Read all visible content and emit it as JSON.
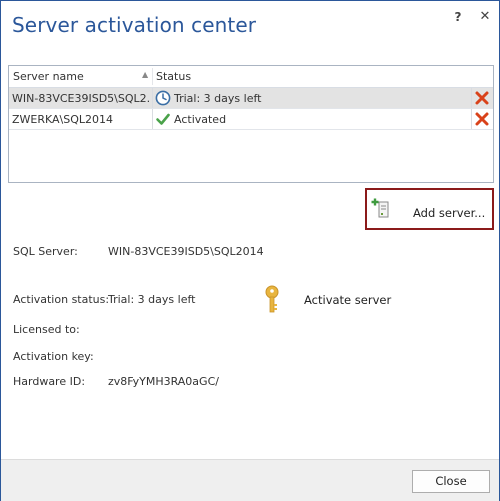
{
  "window": {
    "title": "Server activation center",
    "help_label": "?",
    "close_glyph": "✕"
  },
  "server_list": {
    "columns": {
      "name": "Server name",
      "status": "Status",
      "sort_glyph": "▲"
    },
    "rows": [
      {
        "name": "WIN-83VCE39ISD5\\SQL2...",
        "status": "Trial: 3 days left",
        "status_icon": "clock-icon",
        "selected": true
      },
      {
        "name": "ZWERKA\\SQL2014",
        "status": "Activated",
        "status_icon": "checkmark-icon",
        "selected": false
      }
    ]
  },
  "add_server": {
    "label": "Add server...",
    "icon": "add-server-icon"
  },
  "details": {
    "sql_server_label": "SQL Server:",
    "sql_server_value": "WIN-83VCE39ISD5\\SQL2014",
    "activation_status_label": "Activation status:",
    "activation_status_value": "Trial: 3 days left",
    "licensed_to_label": "Licensed to:",
    "licensed_to_value": "",
    "activation_key_label": "Activation key:",
    "activation_key_value": "",
    "hardware_id_label": "Hardware ID:",
    "hardware_id_value": "zv8FyYMH3RA0aGC/"
  },
  "activate": {
    "label": "Activate server",
    "icon": "key-icon"
  },
  "footer": {
    "close_label": "Close"
  },
  "colors": {
    "title": "#2b579a",
    "delete_icon": "#d9421a",
    "check_icon": "#4aa24a",
    "key_icon": "#e8b53f",
    "highlight_border": "#8b1a1a",
    "selected_row": "#e3e3e3"
  }
}
